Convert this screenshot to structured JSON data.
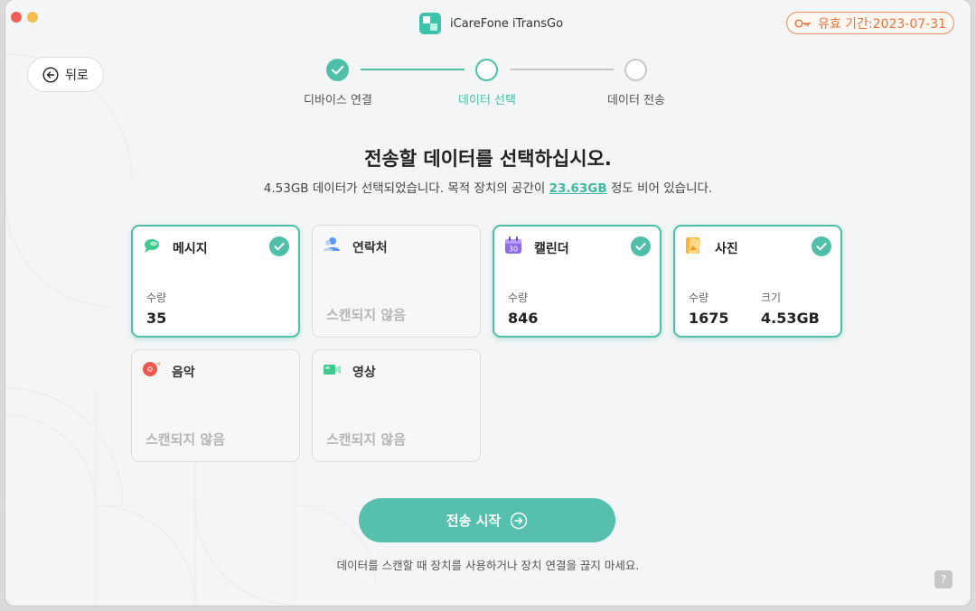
{
  "app": {
    "title": "iCareFone iTransGo"
  },
  "license": {
    "label": "유효 기간:2023-07-31"
  },
  "nav": {
    "back_label": "뒤로"
  },
  "steps": [
    {
      "label": "디바이스 연결",
      "state": "done"
    },
    {
      "label": "데이터 선택",
      "state": "active"
    },
    {
      "label": "데이터 전송",
      "state": "todo"
    }
  ],
  "main": {
    "heading": "전송할 데이터를 선택하십시오.",
    "sub_prefix": "4.53GB 데이터가 선택되었습니다. 목적 장치의 공간이 ",
    "sub_highlight": "23.63GB",
    "sub_suffix": " 정도 비어 있습니다."
  },
  "cards": [
    {
      "title": "메시지",
      "icon": "message-icon",
      "selected": true,
      "count_label": "수량",
      "count": "35"
    },
    {
      "title": "연락처",
      "icon": "contacts-icon",
      "selected": false,
      "status": "스캔되지 않음"
    },
    {
      "title": "캘린더",
      "icon": "calendar-icon",
      "icon_text": "30",
      "selected": true,
      "count_label": "수량",
      "count": "846"
    },
    {
      "title": "사진",
      "icon": "photos-icon",
      "selected": true,
      "count_label": "수량",
      "count": "1675",
      "size_label": "크기",
      "size": "4.53GB"
    },
    {
      "title": "음악",
      "icon": "music-icon",
      "selected": false,
      "status": "스캔되지 않음"
    },
    {
      "title": "영상",
      "icon": "video-icon",
      "selected": false,
      "status": "스캔되지 않음"
    }
  ],
  "actions": {
    "start_label": "전송 시작"
  },
  "footer": {
    "note": "데이터를 스캔할 때 장치를 사용하거나 장치 연결을 끊지 마세요.",
    "help": "?"
  },
  "colors": {
    "accent": "#4fbfa9",
    "license": "#e8743e",
    "button": "#56bfae"
  }
}
